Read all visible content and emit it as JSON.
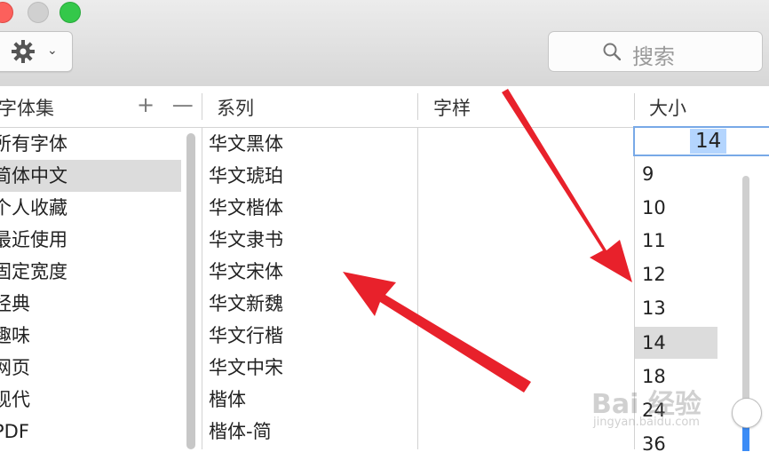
{
  "toolbar": {
    "action_icon": "gear-icon",
    "action_chevron": "⌄",
    "search_placeholder": "搜索"
  },
  "columns": {
    "collections_header": "字体集",
    "add_remove": "+ —",
    "family_header": "系列",
    "typeface_header": "字样",
    "size_header": "大小"
  },
  "collections": [
    {
      "label": "所有字体"
    },
    {
      "label": "简体中文",
      "selected": true
    },
    {
      "label": "个人收藏"
    },
    {
      "label": "最近使用"
    },
    {
      "label": "固定宽度"
    },
    {
      "label": "经典"
    },
    {
      "label": "趣味"
    },
    {
      "label": "网页"
    },
    {
      "label": "现代"
    },
    {
      "label": "PDF"
    }
  ],
  "families": [
    "华文黑体",
    "华文琥珀",
    "华文楷体",
    "华文隶书",
    "华文宋体",
    "华文新魏",
    "华文行楷",
    "华文中宋",
    "楷体",
    "楷体-简"
  ],
  "size": {
    "current": "14",
    "options": [
      "9",
      "10",
      "11",
      "12",
      "13",
      "14",
      "18",
      "24",
      "36"
    ],
    "selected": "14"
  },
  "watermark": {
    "brand": "Bai 经验",
    "url": "jingyan.baidu.com"
  },
  "colors": {
    "arrow": "#e8212b",
    "accent": "#3c8cf6",
    "selection": "#dcdcdc"
  }
}
